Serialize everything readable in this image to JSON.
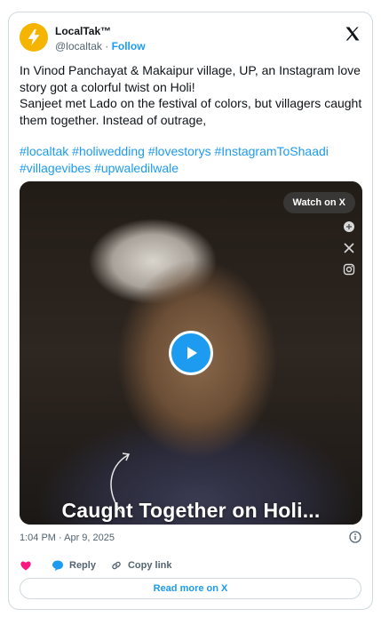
{
  "author": {
    "name": "LocalTak™",
    "handle": "@localtak",
    "separator": "·",
    "follow_label": "Follow"
  },
  "post": {
    "text": "In Vinod Panchayat & Makaipur village, UP, an Instagram love story got a colorful twist on Holi!\nSanjeet met Lado on the festival of colors, but villagers caught them together. Instead of outrage,",
    "hashtags": [
      "#localtak",
      "#holiwedding",
      "#lovestorys",
      "#InstagramToShaadi",
      "#villagevibes",
      "#upwaledilwale"
    ]
  },
  "media": {
    "watch_label": "Watch on X",
    "caption": "Caught Together on Holi..."
  },
  "meta": {
    "timestamp": "1:04 PM · Apr 9, 2025"
  },
  "actions": {
    "reply_label": "Reply",
    "copy_label": "Copy link"
  },
  "read_more_label": "Read more on X",
  "colors": {
    "accent": "#1d9bf0",
    "like": "#f91880",
    "muted": "#536471"
  }
}
